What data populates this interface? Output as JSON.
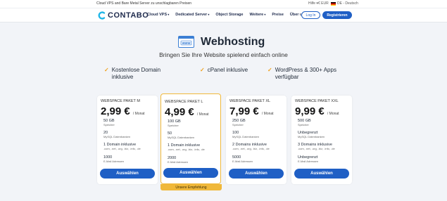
{
  "topbar": {
    "tagline": "Cloud VPS and Bare Metal Server zu unschlagbaren Preisen",
    "help": "Hilfe ▾",
    "currency": "€ EUR",
    "language": "DE - Deutsch"
  },
  "nav": {
    "logo": "CONTABO",
    "items": [
      "Cloud VPS",
      "Dedicated Server",
      "Object Storage",
      "Weitere",
      "Preise",
      "Über uns"
    ],
    "login": "Log In",
    "register": "Registrieren"
  },
  "hero": {
    "icon_label": "WWW",
    "title": "Webhosting",
    "subtitle": "Bringen Sie Ihre Website spielend einfach online"
  },
  "features": [
    "Kostenlose Domain inklusive",
    "cPanel inklusive",
    "WordPress & 300+ Apps verfügbar"
  ],
  "plans": [
    {
      "name": "WEBSPACE PAKET M",
      "price": "2,99 €",
      "per": "/ Monat",
      "storage": "50 GB",
      "storage_label": "Speicher",
      "db": "20",
      "db_label": "MySQL Datenbanken",
      "domain": "1 Domain inklusive",
      "domain_tlds": ".com, .net, .org, .biz, .info, .de",
      "email": "1000",
      "email_label": "E-Mail Adressen",
      "button": "Auswählen"
    },
    {
      "name": "WEBSPACE PAKET L",
      "price": "4,99 €",
      "per": "/ Monat",
      "storage": "100 GB",
      "storage_label": "Speicher",
      "db": "50",
      "db_label": "MySQL Datenbanken",
      "domain": "1 Domain inklusive",
      "domain_tlds": ".com, .net, .org, .biz, .info, .de",
      "email": "2000",
      "email_label": "E-Mail Adressen",
      "button": "Auswählen",
      "badge": "Unsere Empfehlung"
    },
    {
      "name": "WEBSPACE PAKET XL",
      "price": "7,99 €",
      "per": "/ Monat",
      "storage": "250 GB",
      "storage_label": "Speicher",
      "db": "100",
      "db_label": "MySQL Datenbanken",
      "domain": "2 Domains inklusive",
      "domain_tlds": ".com, .net, .org, .biz, .info, .de",
      "email": "5000",
      "email_label": "E-Mail Adressen",
      "button": "Auswählen"
    },
    {
      "name": "WEBSPACE PAKET XXL",
      "price": "9,99 €",
      "per": "/ Monat",
      "storage": "500 GB",
      "storage_label": "Speicher",
      "db": "Unbegrenzt",
      "db_label": "MySQL Datenbanken",
      "domain": "3 Domains inklusive",
      "domain_tlds": ".com, .net, .org, .biz, .info, .de",
      "email": "Unbegrenzt",
      "email_label": "E-Mail Adressen",
      "button": "Auswählen"
    }
  ],
  "colors": {
    "accent": "#1f5fc5",
    "highlight": "#f0b83a",
    "check": "#f0a11c"
  }
}
